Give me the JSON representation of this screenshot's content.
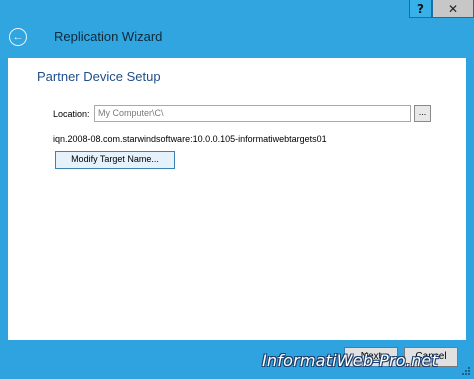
{
  "window": {
    "title": "Replication Wizard",
    "help_glyph": "?",
    "close_glyph": "✕",
    "back_glyph": "←"
  },
  "page": {
    "heading": "Partner Device Setup",
    "location_label": "Location:",
    "location_value": "My Computer\\C\\",
    "browse_label": "...",
    "iqn": "iqn.2008-08.com.starwindsoftware:10.0.0.105-informatiwebtargets01",
    "modify_button": "Modify Target Name..."
  },
  "footer": {
    "next_button": "Next",
    "cancel_button": "Cancel"
  },
  "watermark": {
    "text": "InformatiWeb-Pro.net"
  },
  "colors": {
    "chrome": "#30a5e0",
    "heading": "#1f4e8a"
  }
}
